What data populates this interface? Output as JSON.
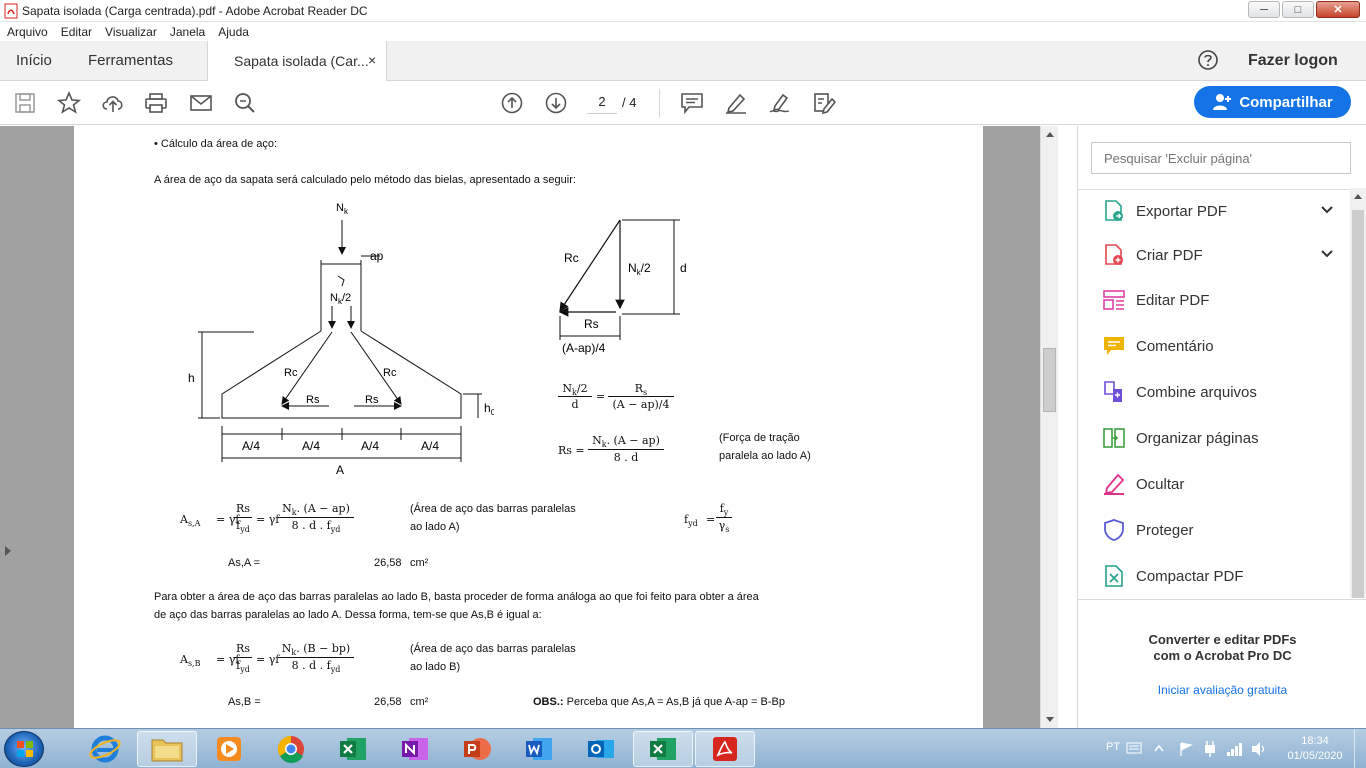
{
  "window": {
    "title": "Sapata isolada (Carga centrada).pdf - Adobe Acrobat Reader DC",
    "minimize": "─",
    "maximize": "□",
    "close": "✕"
  },
  "menu": [
    "Arquivo",
    "Editar",
    "Visualizar",
    "Janela",
    "Ajuda"
  ],
  "tabs": {
    "home": "Início",
    "tools": "Ferramentas",
    "document": "Sapata isolada (Car...",
    "close": "×"
  },
  "header": {
    "login": "Fazer logon"
  },
  "toolbar": {
    "current_page": "2",
    "total_pages": "/ 4",
    "share": "Compartilhar"
  },
  "document": {
    "bullet": "• Cálculo da área de aço:",
    "intro": "A área de aço da sapata será calculado pelo método das bielas, apresentado a seguir:",
    "fig": {
      "nk": "N",
      "nk_sub": "k",
      "ap": "ap",
      "nk2": "N",
      "nk2_sub": "k",
      "nk2_tail": "/2",
      "h": "h",
      "rc_left": "Rc",
      "rc_right": "Rc",
      "rs_left": "Rs",
      "rs_right": "Rs",
      "h0": "h",
      "h0_sub": "0",
      "a4_1": "A/4",
      "a4_2": "A/4",
      "a4_3": "A/4",
      "a4_4": "A/4",
      "a": "A"
    },
    "tri": {
      "rc": "Rc",
      "nk2": "N",
      "nk2_sub": "k",
      "nk2_tail": "/2",
      "d": "d",
      "rs": "Rs",
      "base": "(A-ap)/4"
    },
    "eq1": {
      "num_l": "N",
      "num_l_sub": "k",
      "num_l_tail": "/2",
      "den_l": "d",
      "eq": "=",
      "num_r": "R",
      "num_r_sub": "s",
      "den_r": "(A − ap)/4"
    },
    "eq2": {
      "lhs": "Rs =",
      "num": "N",
      "num_sub": "k",
      "num_tail": ". (A − ap)",
      "den": "8 . d",
      "note1": "(Força de tração",
      "note2": "paralela ao lado A)"
    },
    "eq3": {
      "lhs": "A",
      "lhs_sub": "s,A",
      "eq1": "= γf",
      "n1": "Rs",
      "d1": "f",
      "d1_sub": "yd",
      "eq2": "= γf",
      "n2": "N",
      "n2_sub": "k",
      "n2_tail": ". (A − ap)",
      "d2": "8 . d . f",
      "d2_sub": "yd",
      "note1": "(Área de aço das barras paralelas",
      "note2": "ao lado A)"
    },
    "eq_fyd": {
      "lhs": "f",
      "lhs_sub": "yd",
      "eq": "=",
      "num": "f",
      "num_sub": "y",
      "den": "γ",
      "den_sub": "s"
    },
    "res_a": {
      "label": "As,A =",
      "value": "26,58",
      "unit": "cm²"
    },
    "para_b1": "Para obter a área de aço das barras paralelas ao lado B, basta proceder de forma análoga ao que foi feito para obter a área",
    "para_b2": "de aço das barras paralelas ao lado A. Dessa forma, tem-se que As,B é igual a:",
    "eq4": {
      "lhs": "A",
      "lhs_sub": "s,B",
      "eq1": "= γf",
      "n1": "Rs",
      "d1": "f",
      "d1_sub": "yd",
      "eq2": "= γf",
      "n2": "N",
      "n2_sub": "k",
      "n2_tail": ". (B − bp)",
      "d2": "8 . d . f",
      "d2_sub": "yd",
      "note1": "(Área de aço das barras paralelas",
      "note2": "ao lado B)"
    },
    "res_b": {
      "label": "As,B =",
      "value": "26,58",
      "unit": "cm²",
      "obs_label": "OBS.:",
      "obs_text": " Perceba que As,A = As,B já que A-ap = B-Bp"
    }
  },
  "tools_pane": {
    "search_placeholder": "Pesquisar 'Excluir página'",
    "items": [
      {
        "label": "Exportar PDF",
        "color": "#2aa68f"
      },
      {
        "label": "Criar PDF",
        "color": "#e34850"
      },
      {
        "label": "Editar PDF",
        "color": "#e03fa3"
      },
      {
        "label": "Comentário",
        "color": "#f0b400"
      },
      {
        "label": "Combine arquivos",
        "color": "#6e4fd8"
      },
      {
        "label": "Organizar páginas",
        "color": "#3ea041"
      },
      {
        "label": "Ocultar",
        "color": "#e0348c"
      },
      {
        "label": "Proteger",
        "color": "#5a5ad6"
      },
      {
        "label": "Compactar PDF",
        "color": "#22a08c"
      }
    ],
    "promo_line1": "Converter e editar PDFs",
    "promo_line2": "com o Acrobat Pro DC",
    "trial": "Iniciar avaliação gratuita"
  },
  "taskbar": {
    "lang": "PT",
    "time": "18:34",
    "date": "01/05/2020"
  },
  "colors": {
    "accent": "#1473e6",
    "acrobat_red": "#d7261e"
  }
}
